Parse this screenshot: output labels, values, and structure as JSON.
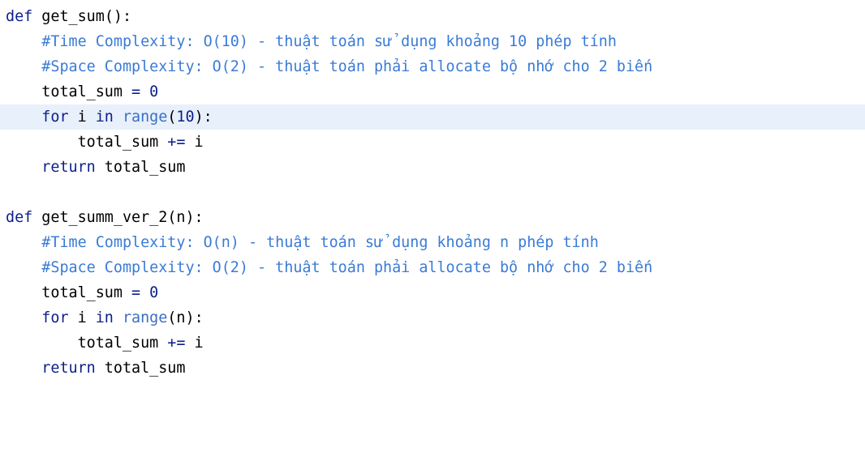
{
  "colors": {
    "keyword": "#0b1e8a",
    "comment": "#3a7bd5",
    "builtin": "#3a6fc4",
    "text": "#000000",
    "highlight": "#e8f0fb"
  },
  "code": {
    "f1": {
      "def": "def",
      "name": "get_sum",
      "params": "():",
      "comment_time": "#Time Complexity: O(10) - thuật toán sử dụng khoảng 10 phép tính",
      "comment_space": "#Space Complexity: O(2) - thuật toán phải allocate bộ nhớ cho 2 biến",
      "init_var": "total_sum",
      "init_op": " = ",
      "init_val": "0",
      "for_kw": "for",
      "loop_var": " i ",
      "in_kw": "in",
      "range_fn": "range",
      "range_open": "(",
      "range_arg": "10",
      "range_close": "):",
      "acc_var": "total_sum",
      "acc_op": " += ",
      "acc_i": "i",
      "return_kw": "return",
      "return_val": " total_sum"
    },
    "f2": {
      "def": "def",
      "name": "get_summ_ver_2",
      "params": "(n):",
      "comment_time": "#Time Complexity: O(n) - thuật toán sử dụng khoảng n phép tính",
      "comment_space": "#Space Complexity: O(2) - thuật toán phải allocate bộ nhớ cho 2 biến",
      "init_var": "total_sum",
      "init_op": " = ",
      "init_val": "0",
      "for_kw": "for",
      "loop_var": " i ",
      "in_kw": "in",
      "range_fn": "range",
      "range_open": "(",
      "range_arg": "n",
      "range_close": "):",
      "acc_var": "total_sum",
      "acc_op": " += ",
      "acc_i": "i",
      "return_kw": "return",
      "return_val": " total_sum"
    }
  }
}
